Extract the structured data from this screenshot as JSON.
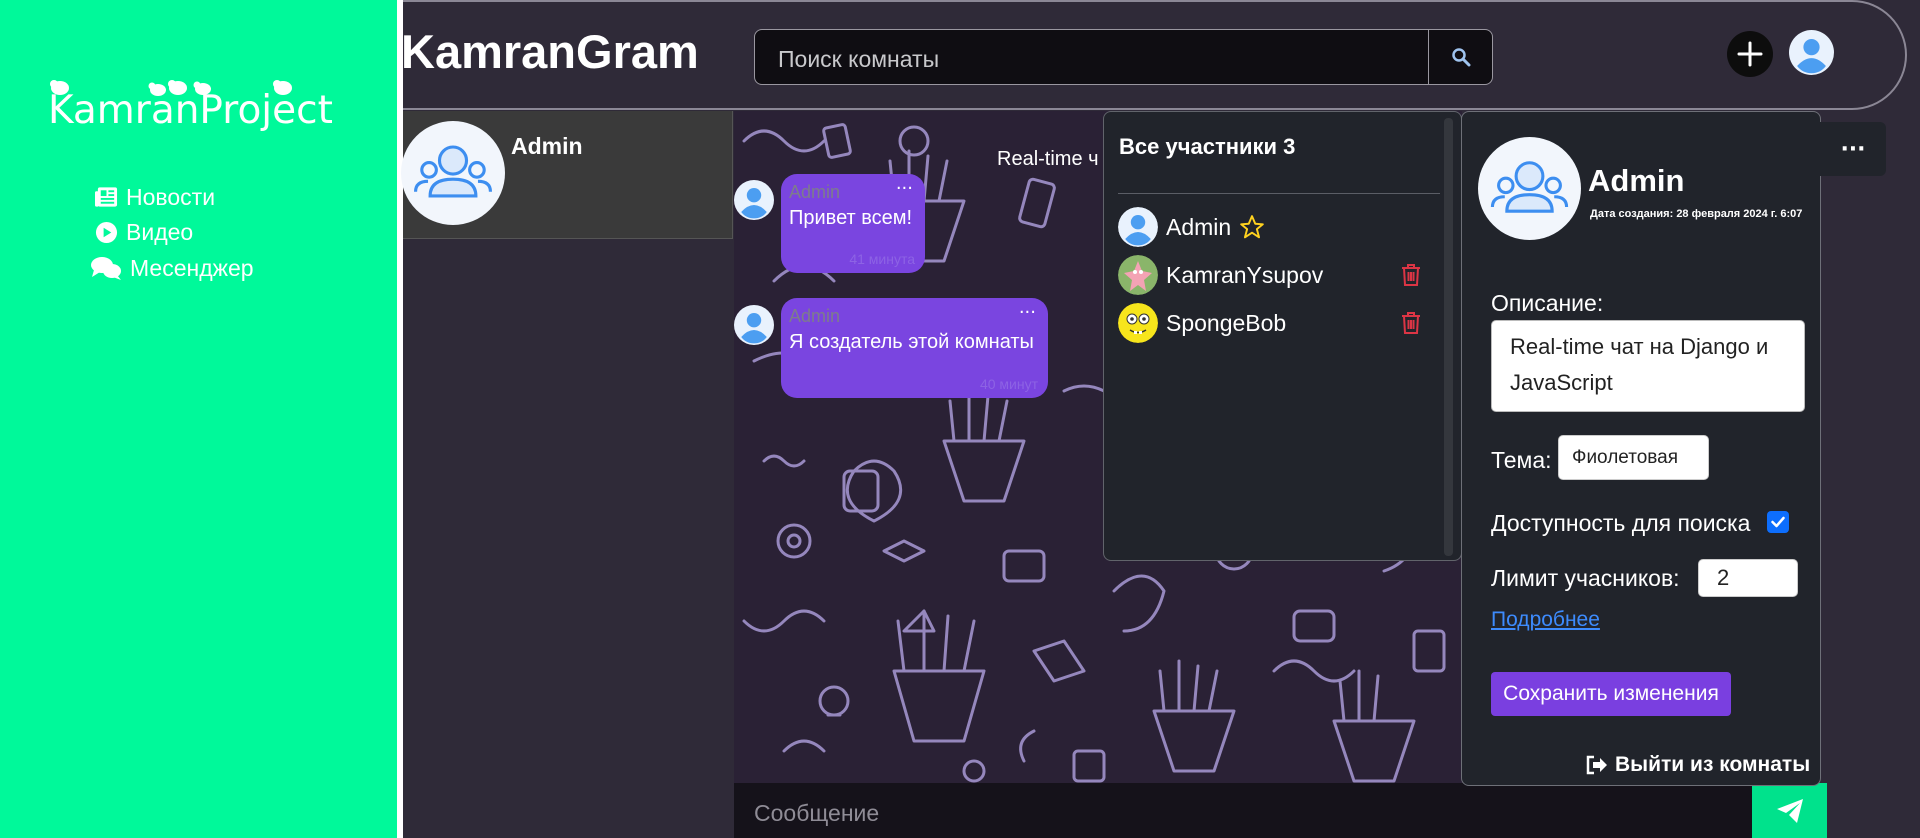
{
  "sidebar": {
    "logo_text": "KamranProject",
    "items": [
      {
        "label": "Новости",
        "icon": "newspaper-icon"
      },
      {
        "label": "Видео",
        "icon": "play-circle-icon"
      },
      {
        "label": "Месенджер",
        "icon": "chat-bubbles-icon"
      }
    ]
  },
  "header": {
    "brand": "KamranGram",
    "search_placeholder": "Поиск комнаты",
    "search_icon": "magnifier-icon",
    "add_icon": "plus-icon"
  },
  "rooms": [
    {
      "name": "Admin"
    }
  ],
  "chat": {
    "title": "Real-time ч",
    "messages": [
      {
        "author": "Admin",
        "text": "Привет всем!",
        "time": "41 минута"
      },
      {
        "author": "Admin",
        "text": "Я создатель этой комнаты",
        "time": "40 минут"
      }
    ],
    "input_placeholder": "Сообщение",
    "menu_dots": "···"
  },
  "members": {
    "title": "Все участники 3",
    "list": [
      {
        "name": "Admin",
        "owner": true
      },
      {
        "name": "KamranYsupov",
        "owner": false
      },
      {
        "name": "SpongeBob",
        "owner": false
      }
    ]
  },
  "room_info": {
    "name": "Admin",
    "created": "Дата создания: 28 февраля 2024 г. 6:07",
    "description_label": "Описание:",
    "description": "Real-time чат на Django и JavaScript",
    "theme_label": "Тема:",
    "theme_value": "Фиолетовая",
    "searchable_label": "Доступность для поиска",
    "searchable": true,
    "limit_label": "Лимит учасников:",
    "limit_value": "2",
    "more_link": "Подробнее",
    "save_label": "Сохранить изменения",
    "leave_label": "Выйти из комнаты"
  },
  "colors": {
    "sidebar": "#00f99a",
    "accent_purple": "#7a45e0",
    "send_green": "#00e28c",
    "panel": "#21242b",
    "delete_red": "#dc3545"
  }
}
